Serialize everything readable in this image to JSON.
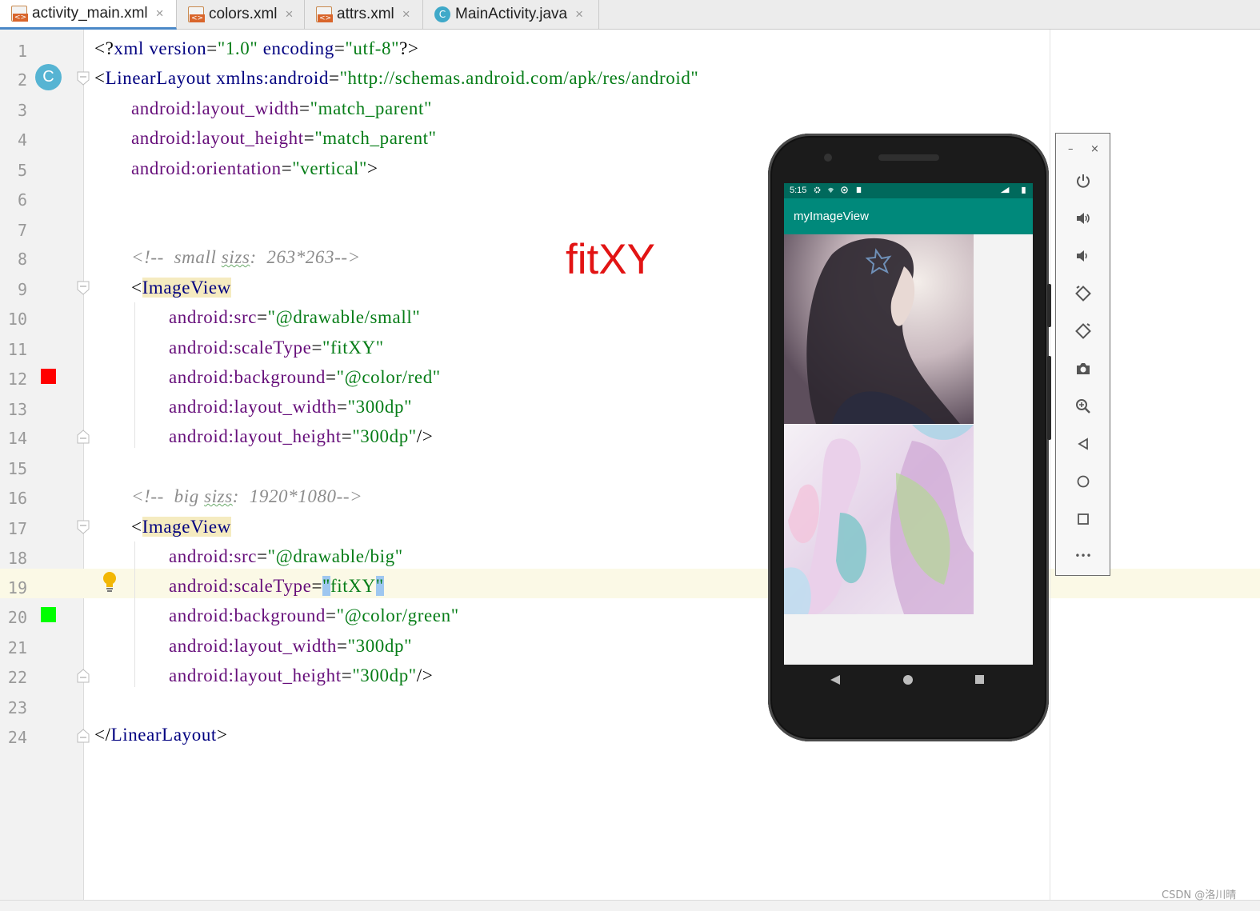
{
  "tabs": [
    {
      "label": "activity_main.xml",
      "icon": "xml-file-icon",
      "active": true
    },
    {
      "label": "colors.xml",
      "icon": "xml-file-icon",
      "active": false
    },
    {
      "label": "attrs.xml",
      "icon": "xml-file-icon",
      "active": false
    },
    {
      "label": "MainActivity.java",
      "icon": "java-class-icon",
      "active": false
    }
  ],
  "tab_close_glyph": "×",
  "gutter": {
    "line_numbers": [
      "1",
      "2",
      "3",
      "4",
      "5",
      "6",
      "7",
      "8",
      "9",
      "10",
      "11",
      "12",
      "13",
      "14",
      "15",
      "16",
      "17",
      "18",
      "19",
      "20",
      "21",
      "22",
      "23",
      "24"
    ],
    "sync_badge": "C",
    "swatch_red": "#ff0000",
    "swatch_green": "#00ff00"
  },
  "code": {
    "l1": {
      "p1": "<?",
      "t1": "xml ",
      "a1": "version",
      "p2": "=",
      "v1": "\"1.0\"",
      "a2": " encoding",
      "p3": "=",
      "v2": "\"utf-8\"",
      "p4": "?>"
    },
    "l2": {
      "p1": "<",
      "t1": "LinearLayout ",
      "a1": "xmlns:android",
      "p2": "=",
      "v1": "\"http://schemas.android.com/apk/res/android\""
    },
    "l3": {
      "a1": "android:layout_width",
      "p1": "=",
      "v1": "\"match_parent\""
    },
    "l4": {
      "a1": "android:layout_height",
      "p1": "=",
      "v1": "\"match_parent\""
    },
    "l5": {
      "a1": "android:orientation",
      "p1": "=",
      "v1": "\"vertical\"",
      "p2": ">"
    },
    "l8": {
      "c1": "<!--  small ",
      "c2": "sizs",
      "c3": ":  263*263-->"
    },
    "l9": {
      "p1": "<",
      "t1": "ImageView"
    },
    "l10": {
      "a1": "android:src",
      "p1": "=",
      "v1": "\"@drawable/small\""
    },
    "l11": {
      "a1": "android:scaleType",
      "p1": "=",
      "v1": "\"fitXY\""
    },
    "l12": {
      "a1": "android:background",
      "p1": "=",
      "v1": "\"@color/red\""
    },
    "l13": {
      "a1": "android:layout_width",
      "p1": "=",
      "v1": "\"300dp\""
    },
    "l14": {
      "a1": "android:layout_height",
      "p1": "=",
      "v1": "\"300dp\"",
      "p2": "/>"
    },
    "l16": {
      "c1": "<!--  big ",
      "c2": "sizs",
      "c3": ":  1920*1080-->"
    },
    "l17": {
      "p1": "<",
      "t1": "ImageView"
    },
    "l18": {
      "a1": "android:src",
      "p1": "=",
      "v1": "\"@drawable/big\""
    },
    "l19": {
      "a1": "android:scaleType",
      "p1": "=",
      "q1": "\"",
      "v1": "fitXY",
      "q2": "\""
    },
    "l20": {
      "a1": "android:background",
      "p1": "=",
      "v1": "\"@color/green\""
    },
    "l21": {
      "a1": "android:layout_width",
      "p1": "=",
      "v1": "\"300dp\""
    },
    "l22": {
      "a1": "android:layout_height",
      "p1": "=",
      "v1": "\"300dp\"",
      "p2": "/>"
    },
    "l24": {
      "p1": "</",
      "t1": "LinearLayout",
      "p2": ">"
    }
  },
  "annotation": "fitXY",
  "emulator": {
    "status_time": "5:15",
    "app_title": "myImageView",
    "status_bar_color": "#00695c",
    "app_bar_color": "#00897b",
    "status_icons": [
      "settings-icon",
      "wifi-icon",
      "sync-icon",
      "sd-card-icon",
      "signal-icon",
      "battery-icon"
    ],
    "nav_icons": [
      "back-icon",
      "home-icon",
      "overview-icon"
    ]
  },
  "emulator_toolbar": {
    "minimize": "–",
    "close": "×",
    "buttons": [
      "power-icon",
      "volume-up-icon",
      "volume-down-icon",
      "rotate-left-icon",
      "rotate-right-icon",
      "camera-icon",
      "zoom-icon",
      "back-icon",
      "home-icon",
      "overview-icon",
      "more-icon"
    ],
    "more_glyph": "•••"
  },
  "watermark": "CSDN @洛川晴"
}
